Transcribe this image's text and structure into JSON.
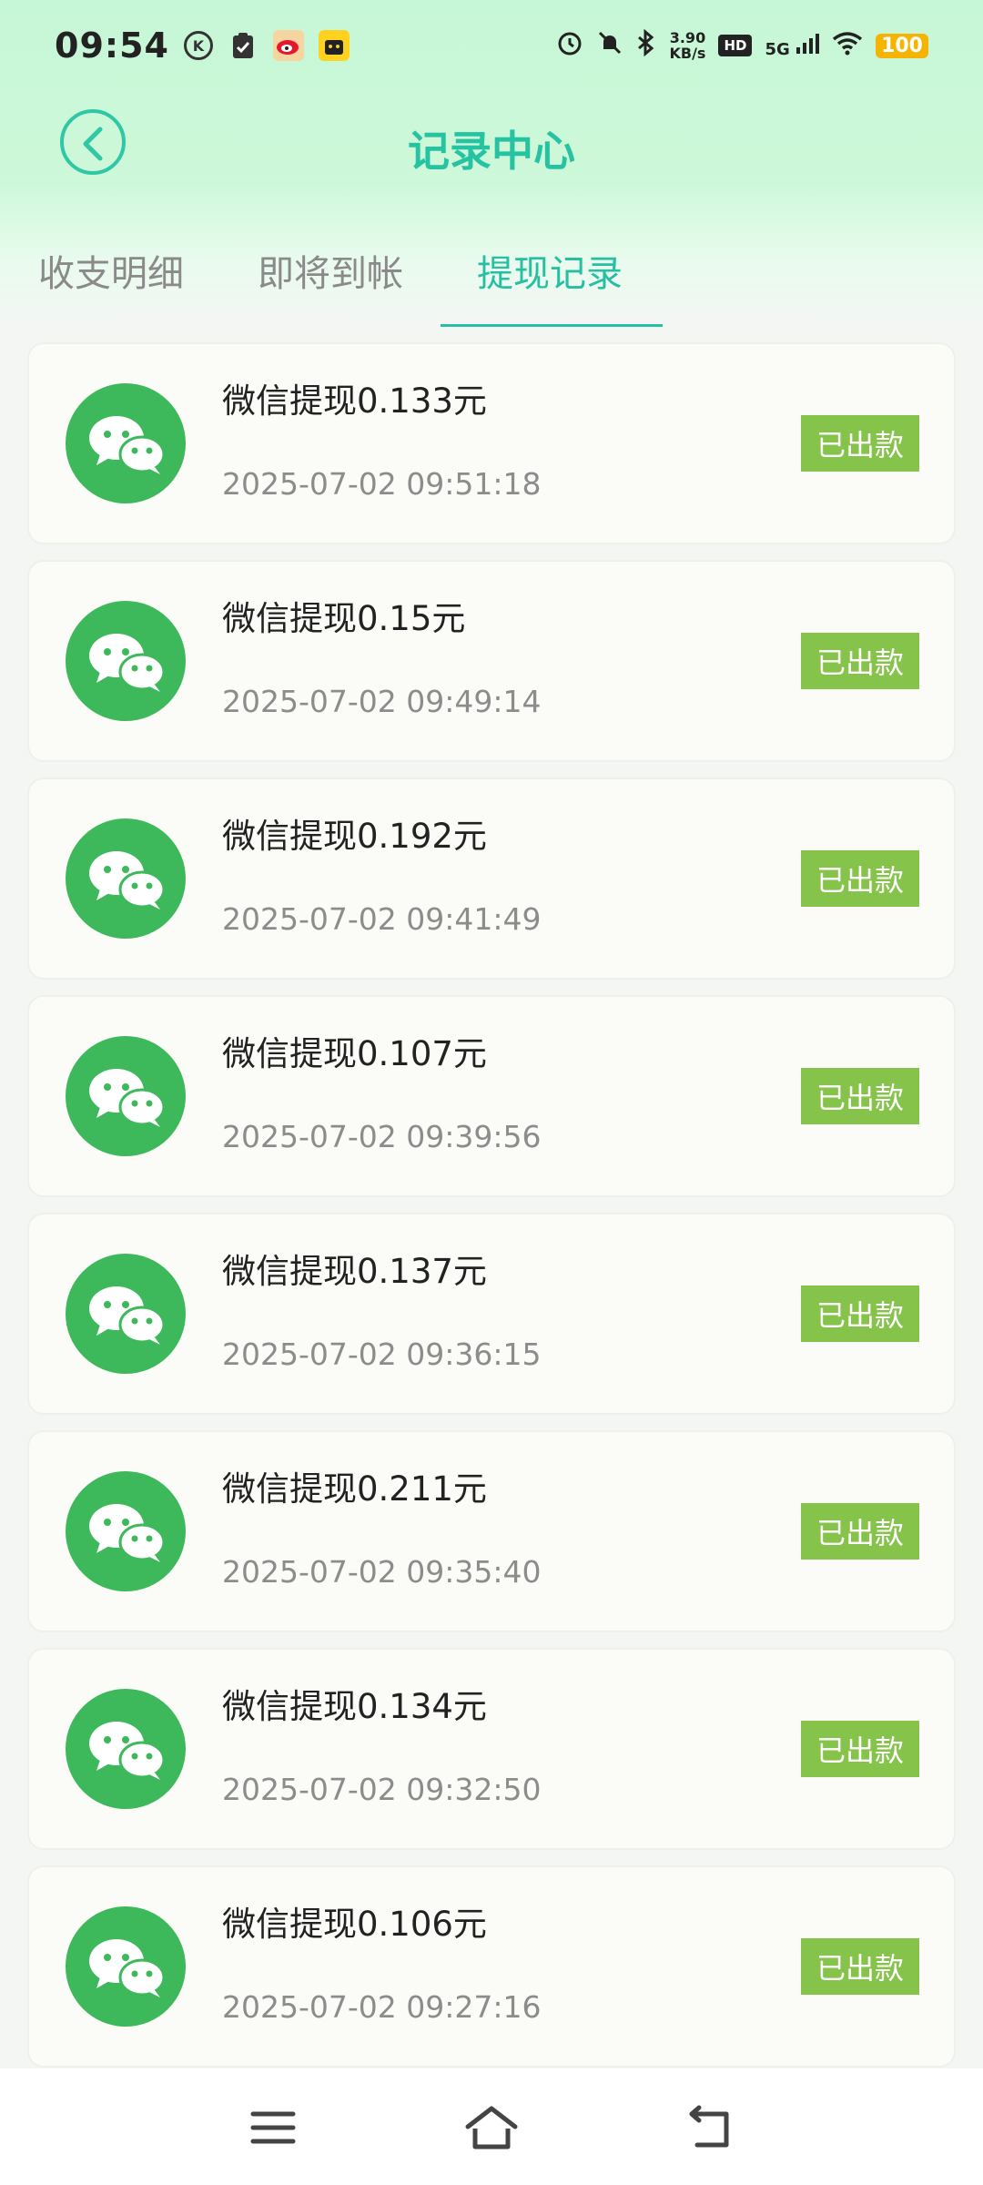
{
  "status_bar": {
    "time": "09:54",
    "net_speed_value": "3.90",
    "net_speed_unit": "KB/s",
    "hd": "HD",
    "signal": "5G",
    "battery": "100"
  },
  "header": {
    "title": "记录中心"
  },
  "tabs": [
    {
      "label": "收支明细"
    },
    {
      "label": "即将到帐"
    },
    {
      "label": "提现记录"
    }
  ],
  "active_tab": "提现记录",
  "records": [
    {
      "title": "微信提现0.133元",
      "time": "2025-07-02 09:51:18",
      "status": "已出款"
    },
    {
      "title": "微信提现0.15元",
      "time": "2025-07-02 09:49:14",
      "status": "已出款"
    },
    {
      "title": "微信提现0.192元",
      "time": "2025-07-02 09:41:49",
      "status": "已出款"
    },
    {
      "title": "微信提现0.107元",
      "time": "2025-07-02 09:39:56",
      "status": "已出款"
    },
    {
      "title": "微信提现0.137元",
      "time": "2025-07-02 09:36:15",
      "status": "已出款"
    },
    {
      "title": "微信提现0.211元",
      "time": "2025-07-02 09:35:40",
      "status": "已出款"
    },
    {
      "title": "微信提现0.134元",
      "time": "2025-07-02 09:32:50",
      "status": "已出款"
    },
    {
      "title": "微信提现0.106元",
      "time": "2025-07-02 09:27:16",
      "status": "已出款"
    }
  ],
  "colors": {
    "accent": "#26c3a3",
    "wechat_green": "#3db85a",
    "badge_green": "#86c34a"
  },
  "icons": {
    "back": "chevron-left-icon",
    "record": "wechat-icon",
    "menu": "menu-icon",
    "home": "home-icon",
    "back_nav": "back-arrow-icon"
  }
}
